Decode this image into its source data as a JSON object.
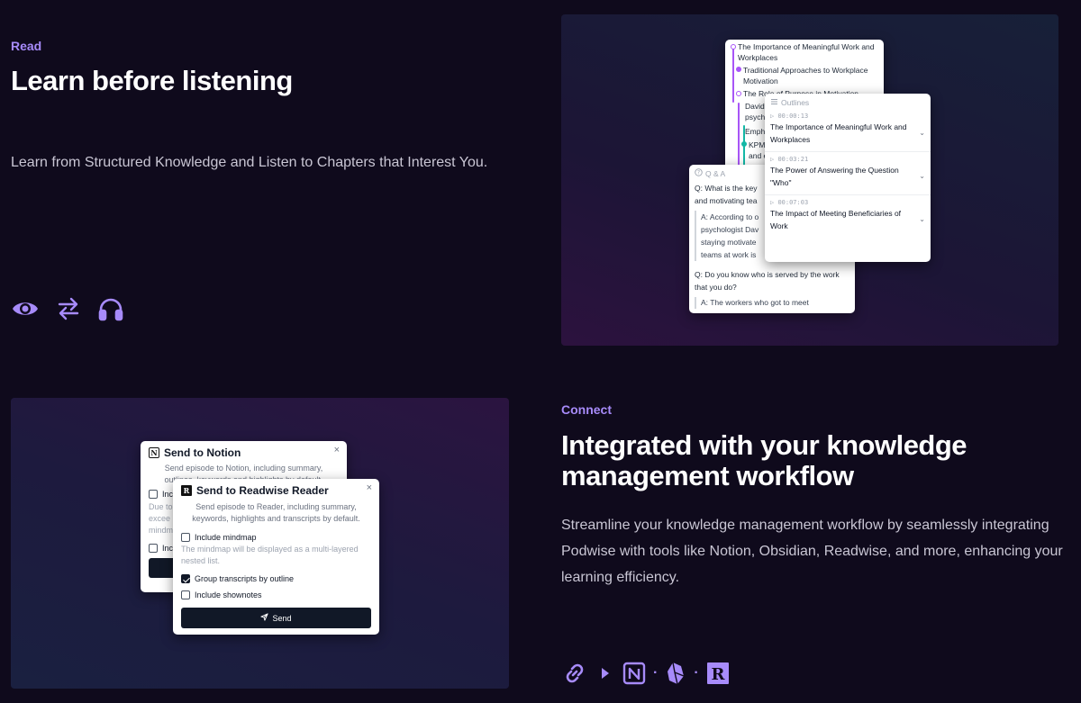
{
  "read": {
    "label": "Read",
    "title": "Learn before listening",
    "description": "Learn from Structured Knowledge and Listen to Chapters that Interest You.",
    "icons": [
      "eye-icon",
      "swap-arrows-icon",
      "headphones-icon"
    ]
  },
  "connect": {
    "label": "Connect",
    "title_line1": "Integrated with your knowledge",
    "title_line2": "management workflow",
    "description": "Streamline your knowledge management workflow by seamlessly integrating Podwise with tools like Notion, Obsidian, Readwise, and more, enhancing your learning efficiency.",
    "icons": [
      "link-icon",
      "play-arrow-icon",
      "notion-icon",
      "obsidian-icon",
      "readwise-icon"
    ],
    "separators": [
      "·",
      "·"
    ]
  },
  "mindmap": {
    "items": [
      "The Importance of Meaningful Work and",
      "Workplaces",
      "Traditional Approaches to Workplace",
      "Motivation",
      "The Role of Purpose in Motivation",
      "David",
      "psych",
      "Emph",
      "KPM",
      "and e"
    ]
  },
  "qa": {
    "header": "Q & A",
    "q1": "Q: What is the key",
    "q1b": "and motivating tea",
    "a1": [
      "A: According to o",
      "psychologist Dav",
      "staying motivate",
      "teams at work is"
    ],
    "q2": "Q: Do you know who is served by the work that you do?",
    "a2": "A: The workers who got to meet"
  },
  "outlines": {
    "header": "Outlines",
    "items": [
      {
        "time": "00:00:13",
        "title": "The Importance of Meaningful Work and Workplaces"
      },
      {
        "time": "00:03:21",
        "title": "The Power of Answering the Question \"Who\""
      },
      {
        "time": "00:07:03",
        "title": "The Impact of Meeting Beneficiaries of Work"
      }
    ]
  },
  "notion_dialog": {
    "title": "Send to Notion",
    "subtitle_line1": "Send episode to Notion, including summary,",
    "subtitle_line2": "outlines, keywords and highlights by default.",
    "partial": [
      "Inclu",
      "Due to",
      "excee",
      "mindm",
      "Inclu"
    ]
  },
  "readwise_dialog": {
    "title": "Send to Readwise Reader",
    "subtitle": "Send episode to Reader, including summary, keywords, highlights and transcripts by default.",
    "options": [
      {
        "label": "Include mindmap",
        "checked": false,
        "hint": "The mindmap will be displayed as a multi-layered nested list."
      },
      {
        "label": "Group transcripts by outline",
        "checked": true,
        "hint": ""
      },
      {
        "label": "Include shownotes",
        "checked": false,
        "hint": ""
      }
    ],
    "send_label": "Send",
    "close_label": "×"
  },
  "colors": {
    "accent": "#a78bfa",
    "background": "#0f0a1c",
    "mindmap_purple": "#a855f7",
    "mindmap_teal": "#14b8a6"
  }
}
